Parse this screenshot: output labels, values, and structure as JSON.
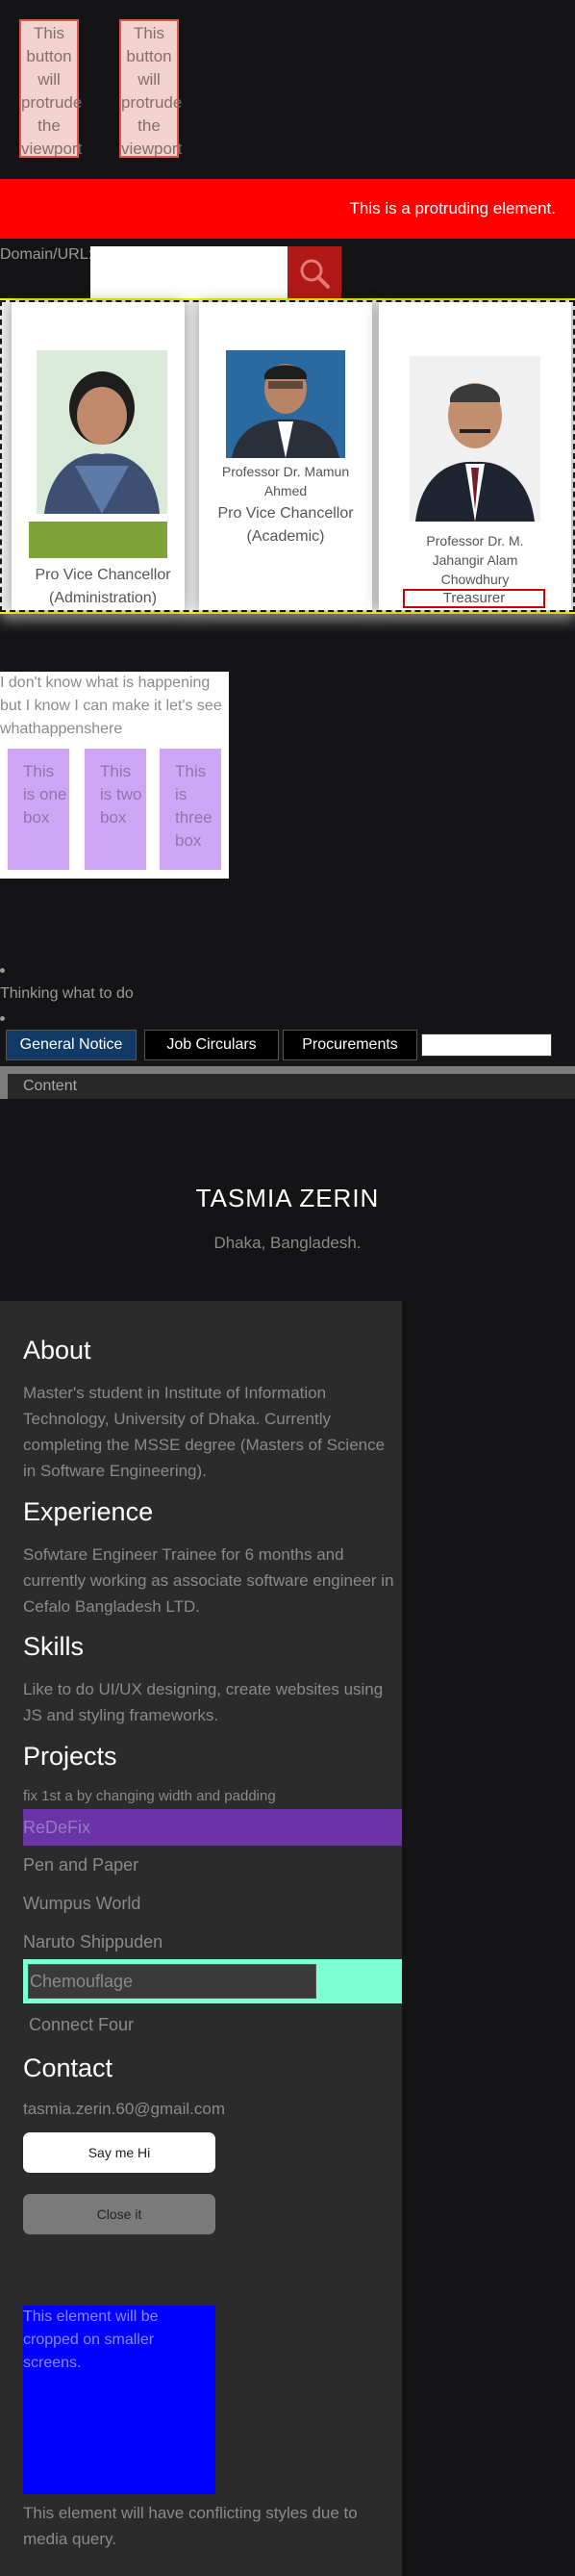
{
  "protrude_buttons": [
    {
      "label": "This button will protrude the viewport"
    },
    {
      "label": "This button will protrude the viewport"
    }
  ],
  "banner": {
    "text": "This is a protruding element."
  },
  "search": {
    "label": "Domain/URL:",
    "value": "",
    "placeholder": ""
  },
  "people": [
    {
      "name": "",
      "designation": "Pro Vice Chancellor (Administration)",
      "label_color": "#7fa43a"
    },
    {
      "name": "Professor Dr. Mamun Ahmed",
      "designation": "Pro Vice Chancellor (Academic)"
    },
    {
      "name": "Professor Dr. M. Jahangir Alam Chowdhury",
      "designation": "Treasurer"
    }
  ],
  "boxes_section": {
    "text": "I don't know what is happening but I know I can make it let's see whathappenshere",
    "boxes": [
      "This is one box",
      "This is two box",
      "This is three box"
    ]
  },
  "bullets": {
    "text": "Thinking what to do"
  },
  "tabs": [
    "General Notice",
    "Job Circulars",
    "Procurements"
  ],
  "content_label": "Content",
  "profile": {
    "name": "TASMIA ZERIN",
    "location": "Dhaka, Bangladesh.",
    "about_heading": "About",
    "about_text": "Master's student in Institute of Information Technology, University of Dhaka. Currently completing the MSSE degree (Masters of Science in Software Engineering).",
    "experience_heading": "Experience",
    "experience_text": "Sofwtare Engineer Trainee for 6 months and currently working as associate software engineer in Cefalo Bangladesh LTD.",
    "skills_heading": "Skills",
    "skills_text": "Like to do UI/UX designing, create websites using JS and styling frameworks.",
    "projects_heading": "Projects",
    "projects_note": "fix 1st a by changing width and padding",
    "projects": [
      "ReDeFix",
      "Pen and Paper",
      "Wumpus World",
      "Naruto Shippuden",
      "Chemouflage",
      "Connect Four"
    ],
    "contact_heading": "Contact",
    "email": "tasmia.zerin.60@gmail.com",
    "say_hi": "Say me Hi",
    "close": "Close it",
    "cropped_text": "This element will be cropped on smaller screens.",
    "conflict_text": "This element will have conflicting styles due to media query."
  },
  "colors": {
    "banner": "#ff0000",
    "search_button": "#b11818",
    "box": "#cfa6f5",
    "active_tab": "#123a66",
    "redefix_bg": "#6a34a6",
    "chemouflage_outer": "#7fffd4",
    "blue_box": "#0000ff"
  }
}
